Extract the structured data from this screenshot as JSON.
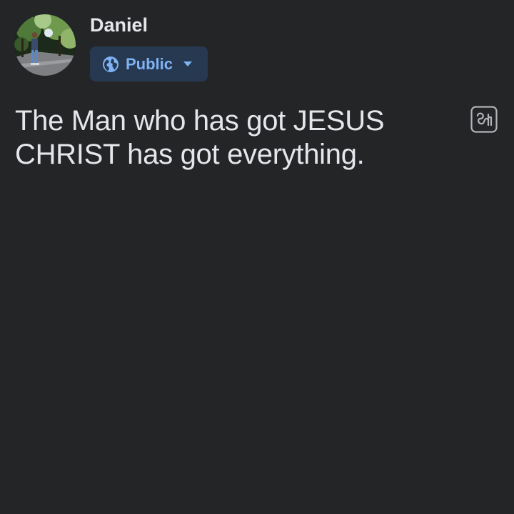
{
  "post": {
    "author_name": "Daniel",
    "audience": {
      "label": "Public",
      "icon": "globe-icon",
      "dropdown_icon": "caret-down-icon"
    },
    "text": "The Man who has got JESUS CHRIST has got everything.",
    "transliterate_icon": "tamil-letter-a-icon"
  },
  "colors": {
    "background": "#242526",
    "text": "#e4e6eb",
    "audience_bg": "#263951",
    "audience_text": "#7fb3f5"
  }
}
